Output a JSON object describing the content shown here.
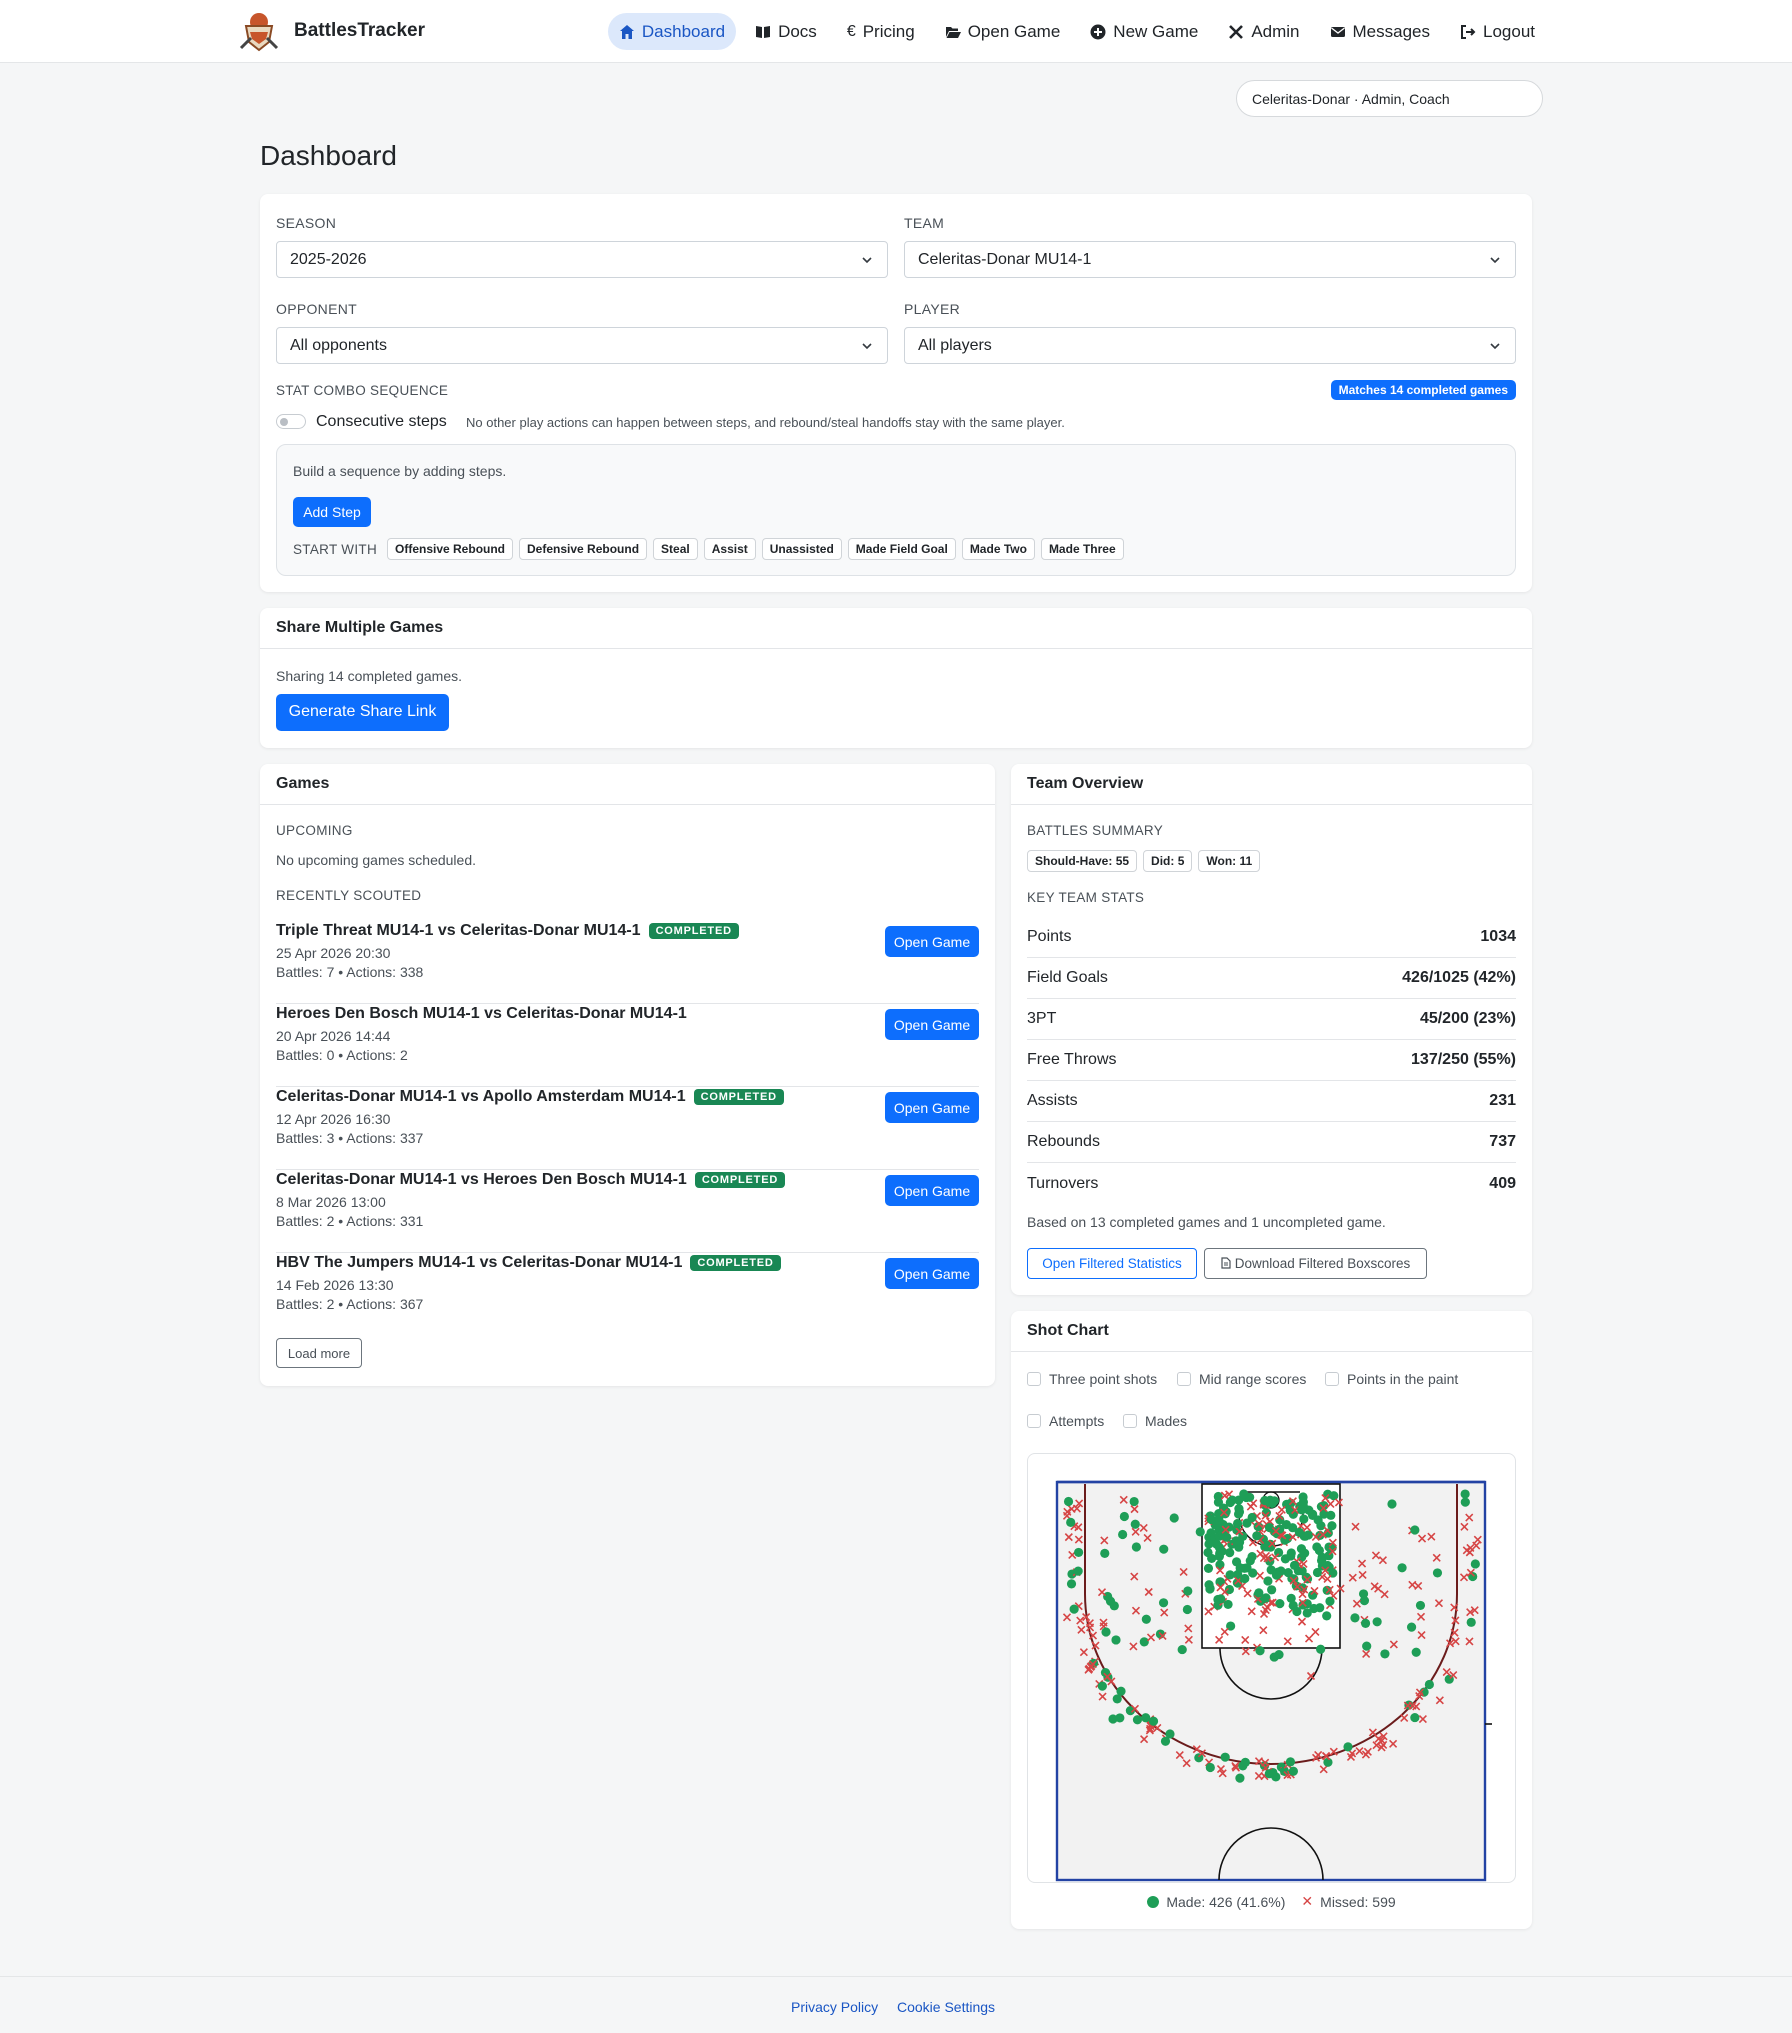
{
  "app": {
    "name": "BattlesTracker"
  },
  "nav": {
    "dashboard": "Dashboard",
    "docs": "Docs",
    "pricing": "Pricing",
    "open_game": "Open Game",
    "new_game": "New Game",
    "admin": "Admin",
    "messages": "Messages",
    "logout": "Logout"
  },
  "user": {
    "label": "Celeritas-Donar · Admin, Coach"
  },
  "page": {
    "title": "Dashboard"
  },
  "filters": {
    "season_label": "SEASON",
    "season_value": "2025-2026",
    "team_label": "TEAM",
    "team_value": "Celeritas-Donar MU14-1",
    "opponent_label": "OPPONENT",
    "opponent_value": "All opponents",
    "player_label": "PLAYER",
    "player_value": "All players",
    "combo_label": "STAT COMBO SEQUENCE",
    "matches_badge": "Matches 14 completed games",
    "consecutive_label": "Consecutive steps",
    "consecutive_help": "No other play actions can happen between steps, and rebound/steal handoffs stay with the same player.",
    "build_hint": "Build a sequence by adding steps.",
    "add_step": "Add Step",
    "start_with": "START WITH",
    "start_options": [
      "Offensive Rebound",
      "Defensive Rebound",
      "Steal",
      "Assist",
      "Unassisted",
      "Made Field Goal",
      "Made Two",
      "Made Three"
    ]
  },
  "share": {
    "title": "Share Multiple Games",
    "text": "Sharing 14 completed games.",
    "button": "Generate Share Link"
  },
  "games": {
    "title": "Games",
    "upcoming_label": "UPCOMING",
    "upcoming_empty": "No upcoming games scheduled.",
    "recent_label": "RECENTLY SCOUTED",
    "open_label": "Open Game",
    "load_more": "Load more",
    "items": [
      {
        "title": "Triple Threat MU14-1 vs Celeritas-Donar MU14-1",
        "status": "COMPLETED",
        "date": "25 Apr 2026 20:30",
        "stats": "Battles: 7 • Actions: 338"
      },
      {
        "title": "Heroes Den Bosch MU14-1 vs Celeritas-Donar MU14-1",
        "status": "",
        "date": "20 Apr 2026 14:44",
        "stats": "Battles: 0 • Actions: 2"
      },
      {
        "title": "Celeritas-Donar MU14-1 vs Apollo Amsterdam MU14-1",
        "status": "COMPLETED",
        "date": "12 Apr 2026 16:30",
        "stats": "Battles: 3 • Actions: 337"
      },
      {
        "title": "Celeritas-Donar MU14-1 vs Heroes Den Bosch MU14-1",
        "status": "COMPLETED",
        "date": "8 Mar 2026 13:00",
        "stats": "Battles: 2 • Actions: 331"
      },
      {
        "title": "HBV The Jumpers MU14-1 vs Celeritas-Donar MU14-1",
        "status": "COMPLETED",
        "date": "14 Feb 2026 13:30",
        "stats": "Battles: 2 • Actions: 367"
      }
    ]
  },
  "overview": {
    "title": "Team Overview",
    "battles_label": "BATTLES SUMMARY",
    "battles": [
      {
        "label": "Should-Have:",
        "value": "55"
      },
      {
        "label": "Did:",
        "value": "5"
      },
      {
        "label": "Won:",
        "value": "11"
      }
    ],
    "key_label": "KEY TEAM STATS",
    "stats": [
      {
        "label": "Points",
        "value": "1034"
      },
      {
        "label": "Field Goals",
        "value": "426/1025 (42%)"
      },
      {
        "label": "3PT",
        "value": "45/200 (23%)"
      },
      {
        "label": "Free Throws",
        "value": "137/250 (55%)"
      },
      {
        "label": "Assists",
        "value": "231"
      },
      {
        "label": "Rebounds",
        "value": "737"
      },
      {
        "label": "Turnovers",
        "value": "409"
      }
    ],
    "note": "Based on 13 completed games and 1 uncompleted game.",
    "open_stats": "Open Filtered Statistics",
    "download": "Download Filtered Boxscores"
  },
  "shotchart": {
    "title": "Shot Chart",
    "filters": [
      "Three point shots",
      "Mid range scores",
      "Points in the paint"
    ],
    "types": [
      "Attempts",
      "Mades"
    ],
    "made_label": "Made: 426 (41.6%)",
    "missed_label": "Missed: 599",
    "made_color": "#1e9e57",
    "missed_color": "#d64545"
  },
  "footer": {
    "privacy": "Privacy Policy",
    "cookies": "Cookie Settings"
  }
}
